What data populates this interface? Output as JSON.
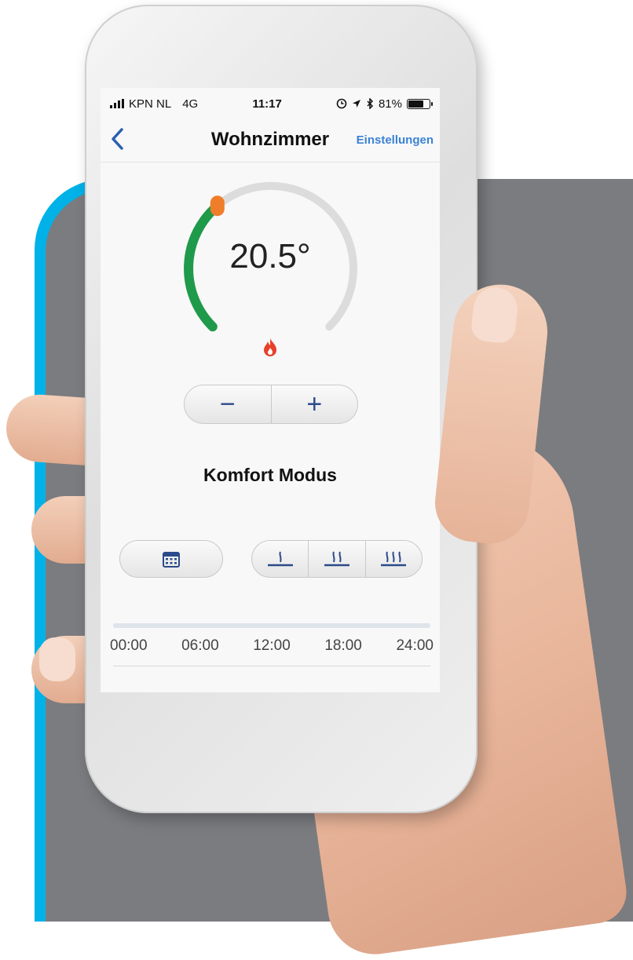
{
  "status_bar": {
    "carrier": "KPN NL",
    "network": "4G",
    "time": "11:17",
    "battery_percent": "81%",
    "battery_level": 0.81,
    "icons": [
      "signal-icon",
      "alarm-icon",
      "location-icon",
      "bluetooth-icon",
      "battery-icon"
    ]
  },
  "nav": {
    "back_icon": "chevron-left-icon",
    "title": "Wohnzimmer",
    "settings_label": "Einstellungen"
  },
  "thermostat": {
    "temperature": "20.5°",
    "dial_level": 0.35,
    "heating_icon": "flame-icon",
    "decrease_label": "−",
    "increase_label": "+"
  },
  "mode": {
    "label": "Komfort Modus"
  },
  "controls": {
    "schedule_icon": "calendar-icon",
    "heat_levels": [
      "heat-level-1-icon",
      "heat-level-2-icon",
      "heat-level-3-icon"
    ]
  },
  "timeline": {
    "labels": [
      "00:00",
      "06:00",
      "12:00",
      "18:00",
      "24:00"
    ]
  },
  "colors": {
    "accent_blue": "#3b82d6",
    "dial_green": "#1f9a4a",
    "dial_orange": "#f07d2a",
    "flame_red": "#e8402a",
    "background_cyan": "#00b2e8",
    "background_grey": "#7b7c80"
  }
}
